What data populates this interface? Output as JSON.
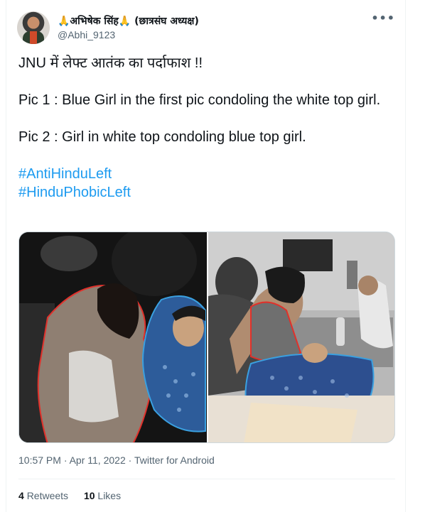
{
  "author": {
    "display_name": "🙏अभिषेक सिंह🙏 (छात्रसंघ अध्यक्ष)",
    "handle": "@Abhi_9123"
  },
  "more_icon": "more-icon",
  "tweet": {
    "line1": "JNU में लेफ्ट आतंक का पर्दाफाश !!",
    "line2": "Pic 1 : Blue Girl in the first pic condoling the white top girl.",
    "line3": "Pic 2 : Girl in white top condoling blue top girl.",
    "hashtags": [
      "#AntiHinduLeft",
      "#HinduPhobicLeft"
    ]
  },
  "meta": {
    "timestamp": "10:57 PM · Apr 11, 2022",
    "separator": " · ",
    "source": "Twitter for Android"
  },
  "stats": {
    "retweets_count": "4",
    "retweets_label": "Retweets",
    "likes_count": "10",
    "likes_label": "Likes"
  },
  "colors": {
    "link": "#1d9bf0",
    "outline_red": "#e0312b",
    "outline_blue": "#3aa0e0"
  }
}
